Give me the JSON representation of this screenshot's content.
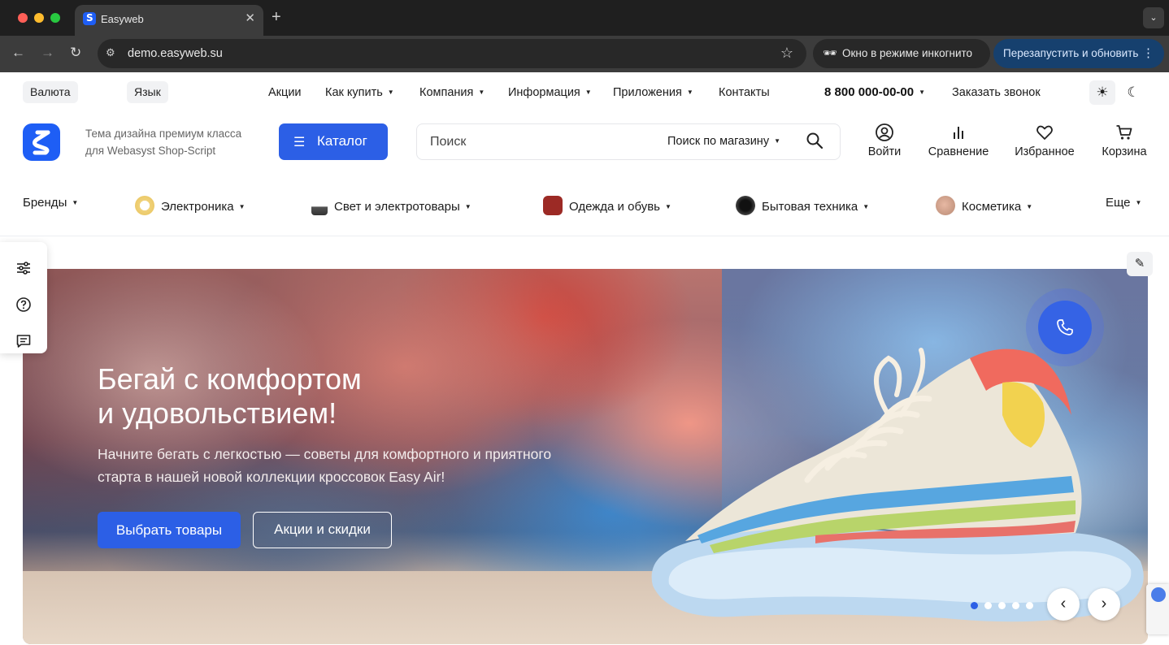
{
  "browser": {
    "tab_title": "Easyweb",
    "tab_close": "✕",
    "new_tab": "+",
    "tab_menu": "⌄",
    "url": "demo.easyweb.su",
    "incognito_label": "Окно в режиме инкогнито",
    "relaunch_label": "Перезапустить и обновить",
    "icons": {
      "back": "←",
      "forward": "→",
      "reload": "↻",
      "star": "☆",
      "menu": "⋮",
      "incognito": "🕶",
      "site_info": "⚙"
    }
  },
  "topbar": {
    "currency": "Валюта",
    "language": "Язык",
    "nav": [
      {
        "label": "Акции",
        "dropdown": false
      },
      {
        "label": "Как купить",
        "dropdown": true
      },
      {
        "label": "Компания",
        "dropdown": true
      },
      {
        "label": "Информация",
        "dropdown": true
      },
      {
        "label": "Приложения",
        "dropdown": true
      },
      {
        "label": "Контакты",
        "dropdown": false
      }
    ],
    "phone": "8 800 000-00-00",
    "callback": "Заказать звонок",
    "theme_light_icon": "☀",
    "theme_dark_icon": "☾"
  },
  "header": {
    "tagline_line1": "Тема дизайна премиум класса",
    "tagline_line2": "для Webasyst Shop-Script",
    "catalog_label": "Каталог",
    "search_placeholder": "Поиск",
    "search_scope": "Поиск по магазину",
    "actions": [
      {
        "label": "Войти",
        "icon": "user-icon"
      },
      {
        "label": "Сравнение",
        "icon": "compare-icon"
      },
      {
        "label": "Избранное",
        "icon": "heart-icon"
      },
      {
        "label": "Корзина",
        "icon": "cart-icon"
      }
    ]
  },
  "categories": [
    {
      "label": "Бренды"
    },
    {
      "label": "Электроника"
    },
    {
      "label": "Свет и электротовары"
    },
    {
      "label": "Одежда и обувь"
    },
    {
      "label": "Бытовая техника"
    },
    {
      "label": "Косметика"
    },
    {
      "label": "Еще"
    }
  ],
  "hero": {
    "title_line1": "Бегай с комфортом",
    "title_line2": "и удовольствием!",
    "subtitle_line1": "Начните бегать с легкостью — советы для комфортного и приятного",
    "subtitle_line2": "старта в нашей новой коллекции кроссовок Easy Air!",
    "primary_button": "Выбрать товары",
    "secondary_button": "Акции и скидки",
    "slides_total": 5,
    "active_slide": 1,
    "prev_icon": "‹",
    "next_icon": "›"
  },
  "colors": {
    "accent": "#2c5fe6",
    "browser_dark": "#1f1f1f",
    "toolbar": "#3c3c3c"
  }
}
